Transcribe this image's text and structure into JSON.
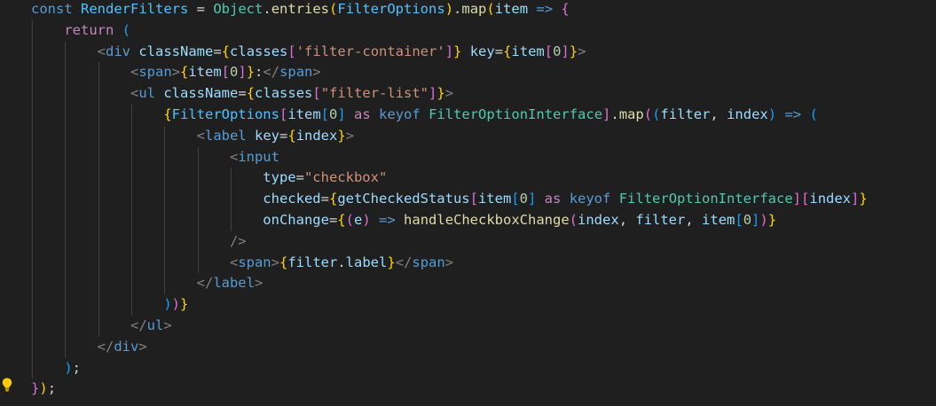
{
  "colors": {
    "background": "#1f1f1f",
    "keyword": "#569cd6",
    "control": "#c586c0",
    "variable": "#9cdcfe",
    "constant": "#4fc1ff",
    "type": "#4ec9b0",
    "function": "#dcdcaa",
    "string": "#ce9178",
    "number": "#b5cea8",
    "tag": "#569cd6",
    "bracket1": "#ffd700",
    "bracket2": "#da70d6",
    "bracket3": "#179fff",
    "punctuation": "#d4d4d4",
    "jsxPunct": "#808080",
    "lightbulb": "#ffcc00"
  },
  "icons": {
    "gutter": "lightbulb-icon"
  },
  "lines": [
    {
      "indent": 0,
      "tokens": [
        {
          "t": "const",
          "c": "keyword"
        },
        {
          "t": " ",
          "c": "punctuation"
        },
        {
          "t": "RenderFilters",
          "c": "constant"
        },
        {
          "t": " = ",
          "c": "punctuation"
        },
        {
          "t": "Object",
          "c": "type"
        },
        {
          "t": ".",
          "c": "punctuation"
        },
        {
          "t": "entries",
          "c": "function"
        },
        {
          "t": "(",
          "c": "bracket1"
        },
        {
          "t": "FilterOptions",
          "c": "constant"
        },
        {
          "t": ")",
          "c": "bracket1"
        },
        {
          "t": ".",
          "c": "punctuation"
        },
        {
          "t": "map",
          "c": "function"
        },
        {
          "t": "(",
          "c": "bracket1"
        },
        {
          "t": "item",
          "c": "variable"
        },
        {
          "t": " ",
          "c": "punctuation"
        },
        {
          "t": "=>",
          "c": "keyword"
        },
        {
          "t": " ",
          "c": "punctuation"
        },
        {
          "t": "{",
          "c": "bracket2"
        }
      ]
    },
    {
      "indent": 1,
      "tokens": [
        {
          "t": "return",
          "c": "control"
        },
        {
          "t": " ",
          "c": "punctuation"
        },
        {
          "t": "(",
          "c": "bracket3"
        }
      ]
    },
    {
      "indent": 2,
      "tokens": [
        {
          "t": "<",
          "c": "jsxPunct"
        },
        {
          "t": "div",
          "c": "tag"
        },
        {
          "t": " ",
          "c": "punctuation"
        },
        {
          "t": "className",
          "c": "variable"
        },
        {
          "t": "=",
          "c": "punctuation"
        },
        {
          "t": "{",
          "c": "bracket1"
        },
        {
          "t": "classes",
          "c": "variable"
        },
        {
          "t": "[",
          "c": "bracket2"
        },
        {
          "t": "'filter-container'",
          "c": "string"
        },
        {
          "t": "]",
          "c": "bracket2"
        },
        {
          "t": "}",
          "c": "bracket1"
        },
        {
          "t": " ",
          "c": "punctuation"
        },
        {
          "t": "key",
          "c": "variable"
        },
        {
          "t": "=",
          "c": "punctuation"
        },
        {
          "t": "{",
          "c": "bracket1"
        },
        {
          "t": "item",
          "c": "variable"
        },
        {
          "t": "[",
          "c": "bracket2"
        },
        {
          "t": "0",
          "c": "number"
        },
        {
          "t": "]",
          "c": "bracket2"
        },
        {
          "t": "}",
          "c": "bracket1"
        },
        {
          "t": ">",
          "c": "jsxPunct"
        }
      ]
    },
    {
      "indent": 3,
      "tokens": [
        {
          "t": "<",
          "c": "jsxPunct"
        },
        {
          "t": "span",
          "c": "tag"
        },
        {
          "t": ">",
          "c": "jsxPunct"
        },
        {
          "t": "{",
          "c": "bracket1"
        },
        {
          "t": "item",
          "c": "variable"
        },
        {
          "t": "[",
          "c": "bracket2"
        },
        {
          "t": "0",
          "c": "number"
        },
        {
          "t": "]",
          "c": "bracket2"
        },
        {
          "t": "}",
          "c": "bracket1"
        },
        {
          "t": ":",
          "c": "punctuation"
        },
        {
          "t": "</",
          "c": "jsxPunct"
        },
        {
          "t": "span",
          "c": "tag"
        },
        {
          "t": ">",
          "c": "jsxPunct"
        }
      ]
    },
    {
      "indent": 3,
      "tokens": [
        {
          "t": "<",
          "c": "jsxPunct"
        },
        {
          "t": "ul",
          "c": "tag"
        },
        {
          "t": " ",
          "c": "punctuation"
        },
        {
          "t": "className",
          "c": "variable"
        },
        {
          "t": "=",
          "c": "punctuation"
        },
        {
          "t": "{",
          "c": "bracket1"
        },
        {
          "t": "classes",
          "c": "variable"
        },
        {
          "t": "[",
          "c": "bracket2"
        },
        {
          "t": "\"filter-list\"",
          "c": "string"
        },
        {
          "t": "]",
          "c": "bracket2"
        },
        {
          "t": "}",
          "c": "bracket1"
        },
        {
          "t": ">",
          "c": "jsxPunct"
        }
      ]
    },
    {
      "indent": 4,
      "tokens": [
        {
          "t": "{",
          "c": "bracket1"
        },
        {
          "t": "FilterOptions",
          "c": "constant"
        },
        {
          "t": "[",
          "c": "bracket2"
        },
        {
          "t": "item",
          "c": "variable"
        },
        {
          "t": "[",
          "c": "bracket3"
        },
        {
          "t": "0",
          "c": "number"
        },
        {
          "t": "]",
          "c": "bracket3"
        },
        {
          "t": " ",
          "c": "punctuation"
        },
        {
          "t": "as",
          "c": "control"
        },
        {
          "t": " ",
          "c": "punctuation"
        },
        {
          "t": "keyof",
          "c": "keyword"
        },
        {
          "t": " ",
          "c": "punctuation"
        },
        {
          "t": "FilterOptionInterface",
          "c": "type"
        },
        {
          "t": "]",
          "c": "bracket2"
        },
        {
          "t": ".",
          "c": "punctuation"
        },
        {
          "t": "map",
          "c": "function"
        },
        {
          "t": "(",
          "c": "bracket2"
        },
        {
          "t": "(",
          "c": "bracket3"
        },
        {
          "t": "filter",
          "c": "variable"
        },
        {
          "t": ", ",
          "c": "punctuation"
        },
        {
          "t": "index",
          "c": "variable"
        },
        {
          "t": ")",
          "c": "bracket3"
        },
        {
          "t": " ",
          "c": "punctuation"
        },
        {
          "t": "=>",
          "c": "keyword"
        },
        {
          "t": " ",
          "c": "punctuation"
        },
        {
          "t": "(",
          "c": "bracket3"
        }
      ]
    },
    {
      "indent": 5,
      "tokens": [
        {
          "t": "<",
          "c": "jsxPunct"
        },
        {
          "t": "label",
          "c": "tag"
        },
        {
          "t": " ",
          "c": "punctuation"
        },
        {
          "t": "key",
          "c": "variable"
        },
        {
          "t": "=",
          "c": "punctuation"
        },
        {
          "t": "{",
          "c": "bracket1"
        },
        {
          "t": "index",
          "c": "variable"
        },
        {
          "t": "}",
          "c": "bracket1"
        },
        {
          "t": ">",
          "c": "jsxPunct"
        }
      ]
    },
    {
      "indent": 6,
      "tokens": [
        {
          "t": "<",
          "c": "jsxPunct"
        },
        {
          "t": "input",
          "c": "tag"
        }
      ]
    },
    {
      "indent": 7,
      "tokens": [
        {
          "t": "type",
          "c": "variable"
        },
        {
          "t": "=",
          "c": "punctuation"
        },
        {
          "t": "\"checkbox\"",
          "c": "string"
        }
      ]
    },
    {
      "indent": 7,
      "tokens": [
        {
          "t": "checked",
          "c": "variable"
        },
        {
          "t": "=",
          "c": "punctuation"
        },
        {
          "t": "{",
          "c": "bracket1"
        },
        {
          "t": "getCheckedStatus",
          "c": "variable"
        },
        {
          "t": "[",
          "c": "bracket2"
        },
        {
          "t": "item",
          "c": "variable"
        },
        {
          "t": "[",
          "c": "bracket3"
        },
        {
          "t": "0",
          "c": "number"
        },
        {
          "t": "]",
          "c": "bracket3"
        },
        {
          "t": " ",
          "c": "punctuation"
        },
        {
          "t": "as",
          "c": "control"
        },
        {
          "t": " ",
          "c": "punctuation"
        },
        {
          "t": "keyof",
          "c": "keyword"
        },
        {
          "t": " ",
          "c": "punctuation"
        },
        {
          "t": "FilterOptionInterface",
          "c": "type"
        },
        {
          "t": "]",
          "c": "bracket2"
        },
        {
          "t": "[",
          "c": "bracket2"
        },
        {
          "t": "index",
          "c": "variable"
        },
        {
          "t": "]",
          "c": "bracket2"
        },
        {
          "t": "}",
          "c": "bracket1"
        }
      ]
    },
    {
      "indent": 7,
      "tokens": [
        {
          "t": "onChange",
          "c": "variable"
        },
        {
          "t": "=",
          "c": "punctuation"
        },
        {
          "t": "{",
          "c": "bracket1"
        },
        {
          "t": "(",
          "c": "bracket2"
        },
        {
          "t": "e",
          "c": "variable"
        },
        {
          "t": ")",
          "c": "bracket2"
        },
        {
          "t": " ",
          "c": "punctuation"
        },
        {
          "t": "=>",
          "c": "keyword"
        },
        {
          "t": " ",
          "c": "punctuation"
        },
        {
          "t": "handleCheckboxChange",
          "c": "function"
        },
        {
          "t": "(",
          "c": "bracket2"
        },
        {
          "t": "index",
          "c": "variable"
        },
        {
          "t": ", ",
          "c": "punctuation"
        },
        {
          "t": "filter",
          "c": "variable"
        },
        {
          "t": ", ",
          "c": "punctuation"
        },
        {
          "t": "item",
          "c": "variable"
        },
        {
          "t": "[",
          "c": "bracket3"
        },
        {
          "t": "0",
          "c": "number"
        },
        {
          "t": "]",
          "c": "bracket3"
        },
        {
          "t": ")",
          "c": "bracket2"
        },
        {
          "t": "}",
          "c": "bracket1"
        }
      ]
    },
    {
      "indent": 6,
      "tokens": [
        {
          "t": "/>",
          "c": "jsxPunct"
        }
      ]
    },
    {
      "indent": 6,
      "tokens": [
        {
          "t": "<",
          "c": "jsxPunct"
        },
        {
          "t": "span",
          "c": "tag"
        },
        {
          "t": ">",
          "c": "jsxPunct"
        },
        {
          "t": "{",
          "c": "bracket1"
        },
        {
          "t": "filter",
          "c": "variable"
        },
        {
          "t": ".",
          "c": "punctuation"
        },
        {
          "t": "label",
          "c": "variable"
        },
        {
          "t": "}",
          "c": "bracket1"
        },
        {
          "t": "</",
          "c": "jsxPunct"
        },
        {
          "t": "span",
          "c": "tag"
        },
        {
          "t": ">",
          "c": "jsxPunct"
        }
      ]
    },
    {
      "indent": 5,
      "tokens": [
        {
          "t": "</",
          "c": "jsxPunct"
        },
        {
          "t": "label",
          "c": "tag"
        },
        {
          "t": ">",
          "c": "jsxPunct"
        }
      ]
    },
    {
      "indent": 4,
      "tokens": [
        {
          "t": ")",
          "c": "bracket3"
        },
        {
          "t": ")",
          "c": "bracket2"
        },
        {
          "t": "}",
          "c": "bracket1"
        }
      ]
    },
    {
      "indent": 3,
      "tokens": [
        {
          "t": "</",
          "c": "jsxPunct"
        },
        {
          "t": "ul",
          "c": "tag"
        },
        {
          "t": ">",
          "c": "jsxPunct"
        }
      ]
    },
    {
      "indent": 2,
      "tokens": [
        {
          "t": "</",
          "c": "jsxPunct"
        },
        {
          "t": "div",
          "c": "tag"
        },
        {
          "t": ">",
          "c": "jsxPunct"
        }
      ]
    },
    {
      "indent": 1,
      "tokens": [
        {
          "t": ")",
          "c": "bracket3"
        },
        {
          "t": ";",
          "c": "punctuation"
        }
      ]
    },
    {
      "indent": 0,
      "tokens": [
        {
          "t": "}",
          "c": "bracket2"
        },
        {
          "t": ")",
          "c": "bracket1"
        },
        {
          "t": ";",
          "c": "punctuation"
        }
      ]
    }
  ]
}
